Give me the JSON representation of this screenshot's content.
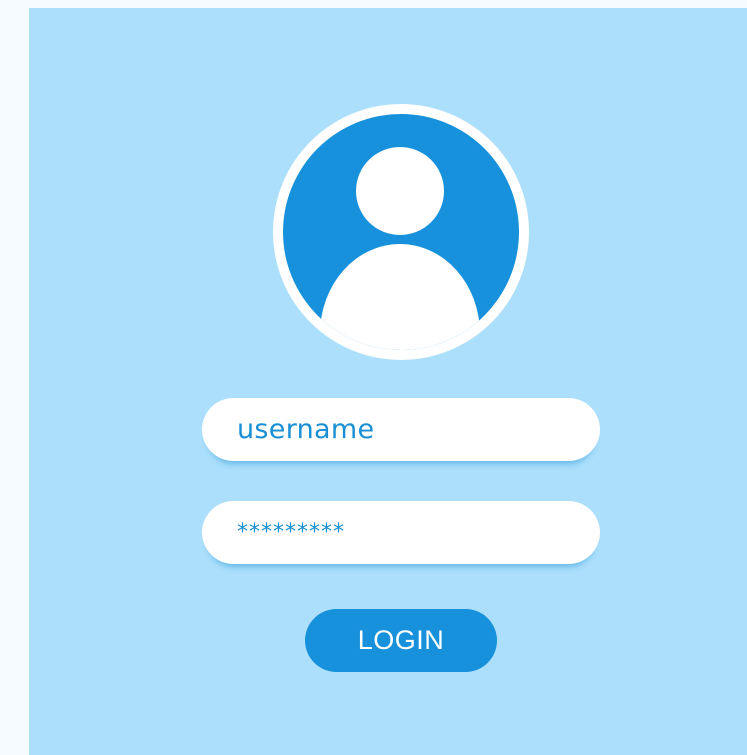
{
  "login_form": {
    "avatar_icon": "user-icon",
    "username_value": "username",
    "password_value": "*********",
    "login_label": "LOGIN"
  },
  "colors": {
    "page_background": "#f5fbfe",
    "panel_background": "#abdffb",
    "accent": "#1791db",
    "field_background": "#ffffff",
    "field_text": "#1a8fd4"
  }
}
